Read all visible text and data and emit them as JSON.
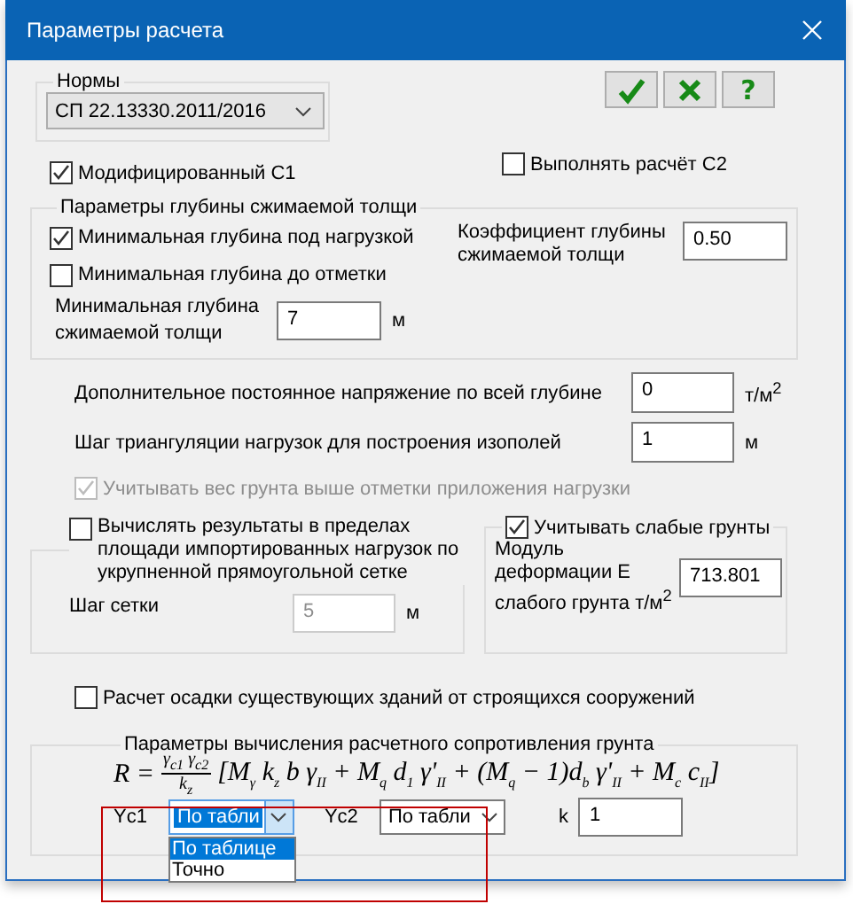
{
  "window": {
    "title": "Параметры расчета"
  },
  "norms": {
    "label": "Нормы",
    "value": "СП 22.13330.2011/2016"
  },
  "toolbar": [
    {
      "kind": "ok"
    },
    {
      "kind": "cancel"
    },
    {
      "kind": "help",
      "label": "?"
    }
  ],
  "modified_c1": {
    "label": "Модифицированный С1",
    "checked": true
  },
  "compute_c2": {
    "label": "Выполнять расчёт С2",
    "checked": false
  },
  "depth_group": {
    "title": "Параметры глубины сжимаемой толщи",
    "options": [
      {
        "label": "Минимальная глубина под нагрузкой",
        "checked": true
      },
      {
        "label": "Минимальная глубина до отметки",
        "checked": false
      }
    ],
    "coefficient": {
      "label": "Коэффициент глубины сжимаемой толщи",
      "value": "0.50"
    },
    "min_depth": {
      "label": "Минимальная глубина сжимаемой толщи",
      "value": "7",
      "unit": "м"
    }
  },
  "params": [
    {
      "label": "Дополнительное постоянное напряжение по всей глубине",
      "value": "0",
      "unit": "т/м$^{2}$"
    },
    {
      "label": "Шаг триангуляции нагрузок для построения изополей",
      "value": "1",
      "unit": "м"
    }
  ],
  "soil_weight": {
    "label": "Учитывать вес грунта выше отметки приложения нагрузки",
    "checked": true,
    "disabled": true
  },
  "grid_group": {
    "label": "Вычислять результаты в пределах площади импортированных нагрузок по укрупненной прямоугольной сетке",
    "checked": false,
    "step": {
      "label": "Шаг сетки",
      "value": "5",
      "unit": "м",
      "disabled": true
    }
  },
  "weak_group": {
    "label": "Учитывать слабые грунты",
    "checked": true,
    "modulus": {
      "label": "Модуль деформации Е слабого грунта т/м$^{2}$",
      "value": "713.801"
    }
  },
  "settlement": {
    "label": "Расчет осадки существующих зданий от строящихся сооружений",
    "checked": false
  },
  "resistance_group": {
    "title": "Параметры вычисления расчетного сопротивления грунта",
    "formula": {
      "lhs": "R =",
      "numerator": "γ$_{c1}$ γ$_{c2}$",
      "denominator": "k$_{z}$",
      "rhs": "[M$_{γ}$ k$_{z}$ b γ$_{II}$ + M$_{q}$ d$_{1}$ γ'$_{II}$ + (M$_{q}$ − 1)d$_{b}$ γ'$_{II}$ + M$_{c}$ c$_{II}$]"
    },
    "combos": [
      {
        "label": "Yc1",
        "value": "По табли",
        "focused": true,
        "open": true,
        "options": [
          {
            "label": "По таблице",
            "selected": true
          },
          {
            "label": "Точно",
            "selected": false
          }
        ]
      },
      {
        "label": "Yc2",
        "value": "По табли",
        "focused": false,
        "open": false
      }
    ],
    "k": {
      "label": "k",
      "value": "1"
    },
    "highlighted": true
  }
}
